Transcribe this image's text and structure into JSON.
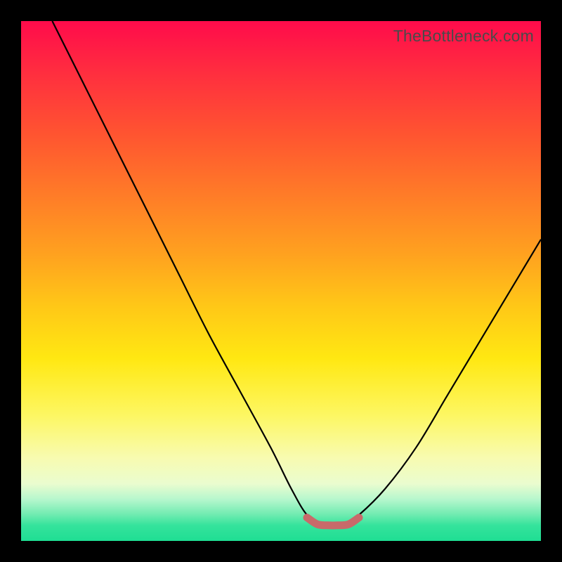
{
  "watermark": "TheBottleneck.com",
  "chart_data": {
    "type": "line",
    "title": "",
    "xlabel": "",
    "ylabel": "",
    "xlim": [
      0,
      100
    ],
    "ylim": [
      0,
      100
    ],
    "series": [
      {
        "name": "bottleneck-curve",
        "x": [
          6,
          12,
          18,
          24,
          30,
          36,
          42,
          48,
          52,
          55,
          58,
          62,
          65,
          70,
          76,
          82,
          88,
          94,
          100
        ],
        "y": [
          100,
          88,
          76,
          64,
          52,
          40,
          29,
          18,
          10,
          5,
          3,
          3,
          5,
          10,
          18,
          28,
          38,
          48,
          58
        ]
      },
      {
        "name": "optimal-band",
        "x": [
          55,
          57,
          59,
          61,
          63,
          65
        ],
        "y": [
          4.5,
          3.2,
          3,
          3,
          3.2,
          4.5
        ]
      }
    ],
    "colors": {
      "curve": "#000000",
      "optimal_band": "#c86a6a",
      "gradient_top": "#ff0b4b",
      "gradient_mid": "#ffe812",
      "gradient_bottom": "#1fde93"
    }
  }
}
